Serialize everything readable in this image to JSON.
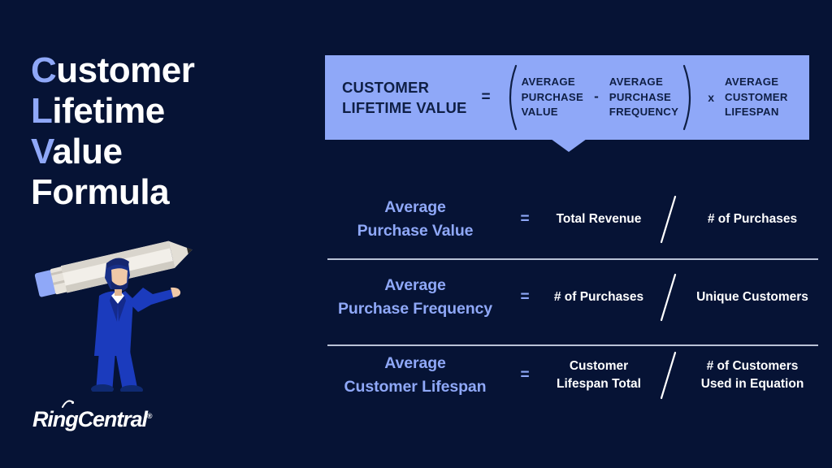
{
  "background_color": "#061335",
  "accent_color": "#8fa8f8",
  "box_color": "#8fa8f8",
  "text_color": "#ffffff",
  "dark_text_color": "#0f1f45",
  "title": {
    "line1_accent": "C",
    "line1_rest": "ustomer",
    "line2_accent": "L",
    "line2_rest": "ifetime",
    "line3_accent": "V",
    "line3_rest": "alue",
    "line4": "Formula"
  },
  "logo": {
    "name": "RingCentral",
    "registered_mark": "®",
    "icon": "signal-arc-icon"
  },
  "illustration": {
    "name": "man-carrying-pencil-illustration",
    "description": "Man in blue suit with beard carrying a large pencil on his shoulder"
  },
  "formula_box": {
    "left_label_line1": "CUSTOMER",
    "left_label_line2": "LIFETIME VALUE",
    "equals": "=",
    "open_paren": "(",
    "close_paren": ")",
    "term1_line1": "AVERAGE",
    "term1_line2": "PURCHASE",
    "term1_line3": "VALUE",
    "inner_operator": "-",
    "term2_line1": "AVERAGE",
    "term2_line2": "PURCHASE",
    "term2_line3": "FREQUENCY",
    "outer_operator": "x",
    "term3_line1": "AVERAGE",
    "term3_line2": "CUSTOMER",
    "term3_line3": "LIFESPAN"
  },
  "rows": [
    {
      "label_line1": "Average",
      "label_line2": "Purchase Value",
      "equals": "=",
      "numerator_line1": "Total Revenue",
      "numerator_line2": "",
      "divider": "/",
      "denominator_line1": "# of Purchases",
      "denominator_line2": ""
    },
    {
      "label_line1": "Average",
      "label_line2": "Purchase Frequency",
      "equals": "=",
      "numerator_line1": "# of Purchases",
      "numerator_line2": "",
      "divider": "/",
      "denominator_line1": "Unique Customers",
      "denominator_line2": ""
    },
    {
      "label_line1": "Average",
      "label_line2": "Customer Lifespan",
      "equals": "=",
      "numerator_line1": "Customer",
      "numerator_line2": "Lifespan Total",
      "divider": "/",
      "denominator_line1": "# of Customers",
      "denominator_line2": "Used in Equation"
    }
  ]
}
